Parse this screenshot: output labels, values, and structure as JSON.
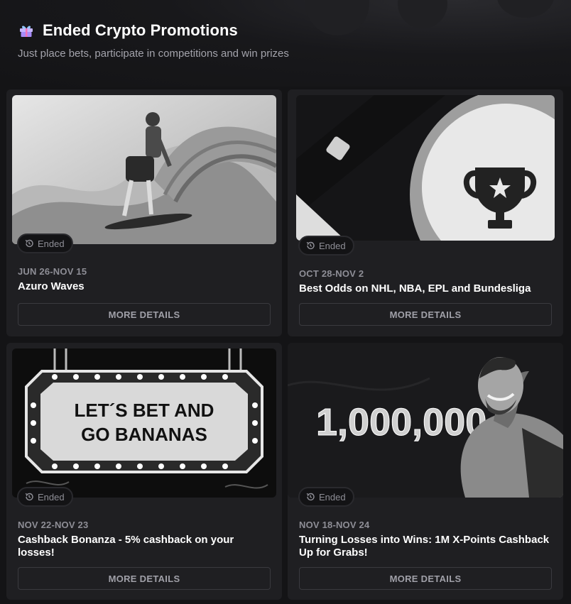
{
  "header": {
    "title": "Ended Crypto Promotions",
    "subtitle": "Just place bets, participate in competitions and win prizes"
  },
  "promotions": [
    {
      "dates": "JUN 26-NOV 15",
      "title": "Azuro Waves",
      "status": "Ended",
      "button": "MORE DETAILS"
    },
    {
      "dates": "OCT 28-NOV 2",
      "title": "Best Odds on NHL, NBA, EPL and Bundesliga",
      "status": "Ended",
      "button": "MORE DETAILS"
    },
    {
      "dates": "NOV 22-NOV 23",
      "title": "Cashback Bonanza - 5% cashback on your losses!",
      "status": "Ended",
      "button": "MORE DETAILS",
      "image_text_line1": "LET´S BET AND",
      "image_text_line2": "GO BANANAS"
    },
    {
      "dates": "NOV 18-NOV 24",
      "title": "Turning Losses into Wins: 1M X-Points Cashback Up for Grabs!",
      "status": "Ended",
      "button": "MORE DETAILS",
      "image_text": "1,000,000"
    }
  ],
  "icons": {
    "header": "gift-icon",
    "badge": "history-icon"
  },
  "colors": {
    "background": "#141416",
    "card": "#1f1f22",
    "muted_text": "#8e8e96"
  }
}
